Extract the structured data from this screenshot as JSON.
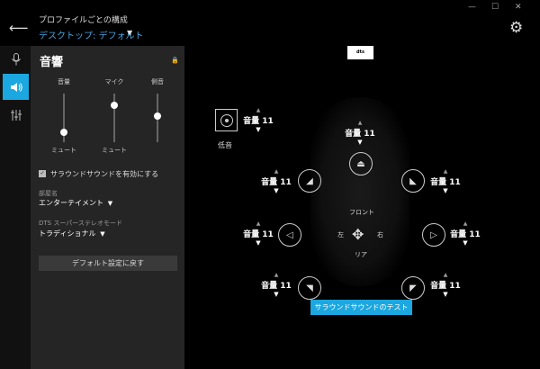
{
  "window": {
    "minimize": "—",
    "maximize": "☐",
    "close": "✕"
  },
  "header": {
    "subtitle": "プロファイルごとの構成",
    "profile": "デスクトップ: デフォルト"
  },
  "panel": {
    "title": "音響",
    "sliders": [
      {
        "label": "音量",
        "value_label": "ミュート",
        "level": 0.15
      },
      {
        "label": "マイク",
        "value_label": "ミュート",
        "level": 0.8
      },
      {
        "label": "側音",
        "value_label": "",
        "level": 0.55
      }
    ],
    "surround_checkbox": {
      "label": "サラウンドサウンドを有効にする",
      "checked": true
    },
    "room": {
      "label": "部屋名",
      "value": "エンターテイメント"
    },
    "dts": {
      "label": "DTS スーパーステレオモード",
      "value": "トラディショナル"
    },
    "reset_button": "デフォルト設定に戻す"
  },
  "dts_logo": "dts HEADPHONE X",
  "speakers": {
    "sub": {
      "label": "低音",
      "volume": "音量 11"
    },
    "center": {
      "volume": "音量 11"
    },
    "front_left": {
      "volume": "音量 11"
    },
    "front_right": {
      "volume": "音量 11"
    },
    "side_left": {
      "volume": "音量 11"
    },
    "side_right": {
      "volume": "音量 11"
    },
    "rear_left": {
      "volume": "音量 11"
    },
    "rear_right": {
      "volume": "音量 11"
    }
  },
  "directions": {
    "front": "フロント",
    "rear": "リア",
    "left": "左",
    "right": "右"
  },
  "test_button": "サラウンドサウンドのテスト",
  "colors": {
    "accent": "#1ba7e0",
    "panel": "#252525",
    "background": "#000000"
  }
}
